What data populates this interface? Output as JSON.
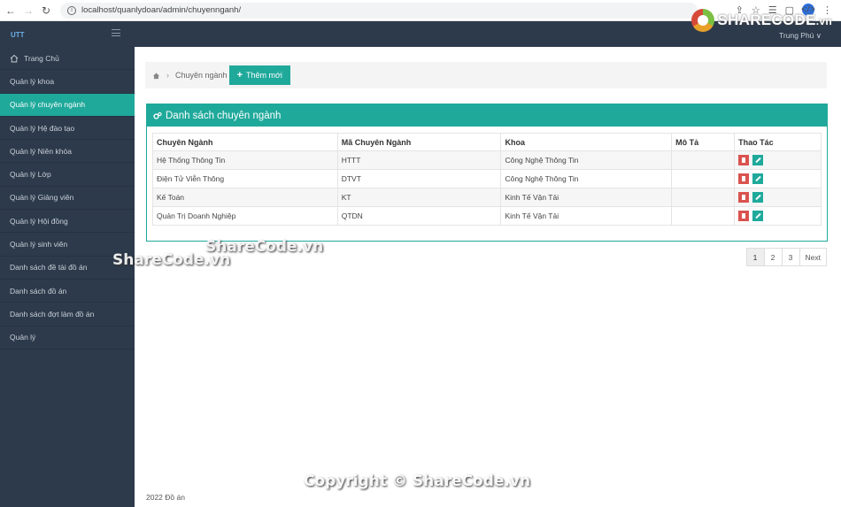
{
  "browser": {
    "url": "localhost/quanlydoan/admin/chuyennganh/"
  },
  "header": {
    "brand": "UTT",
    "user": "Trung Phú ∨",
    "logo_text": "SHARECODE",
    "logo_suffix": ".vn"
  },
  "sidebar": {
    "items": [
      {
        "label": "Trang Chủ"
      },
      {
        "label": "Quản lý khoa"
      },
      {
        "label": "Quản lý chuyên ngành"
      },
      {
        "label": "Quản lý Hệ đào tạo"
      },
      {
        "label": "Quản lý Niên khóa"
      },
      {
        "label": "Quản lý Lớp"
      },
      {
        "label": "Quản lý Giảng viên"
      },
      {
        "label": "Quản lý Hội đồng"
      },
      {
        "label": "Quản lý sinh viên"
      },
      {
        "label": "Danh sách đề tài đồ án"
      },
      {
        "label": "Danh sách đồ án"
      },
      {
        "label": "Danh sách đợt làm đồ án"
      },
      {
        "label": "Quản lý"
      }
    ]
  },
  "breadcrumb": {
    "current": "Chuyên ngành",
    "add_label": "Thêm mới"
  },
  "panel": {
    "title": "Danh sách chuyên ngành"
  },
  "table": {
    "headers": [
      "Chuyên Ngành",
      "Mã Chuyên Ngành",
      "Khoa",
      "Mô Tả",
      "Thao Tác"
    ],
    "rows": [
      [
        "Hệ Thống Thông Tin",
        "HTTT",
        "Công Nghệ Thông Tin",
        ""
      ],
      [
        "Điện Tử Viễn Thông",
        "DTVT",
        "Công Nghệ Thông Tin",
        ""
      ],
      [
        "Kế Toán",
        "KT",
        "Kinh Tế Vận Tải",
        ""
      ],
      [
        "Quản Trị Doanh Nghiệp",
        "QTDN",
        "Kinh Tế Vận Tải",
        ""
      ]
    ]
  },
  "pagination": {
    "pages": [
      "1",
      "2",
      "3"
    ],
    "next": "Next"
  },
  "footer": {
    "text": "2022 Đồ án"
  },
  "watermarks": {
    "w1": "ShareCode.vn",
    "w2": "ShareCode.vn",
    "w3": "Copyright © ShareCode.vn"
  }
}
